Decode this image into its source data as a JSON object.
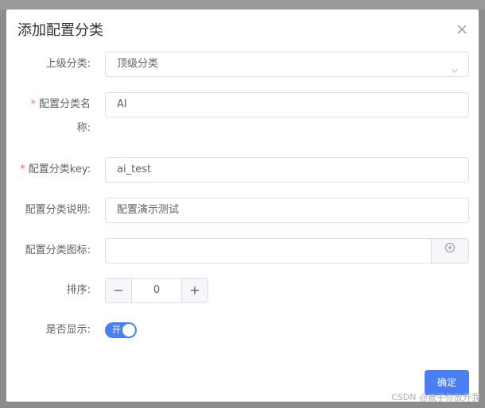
{
  "dialog": {
    "title": "添加配置分类"
  },
  "form": {
    "parent": {
      "label": "上级分类:",
      "value": "顶级分类"
    },
    "name": {
      "required_mark": "*",
      "label_line1": "配置分类名",
      "label_line2": "称:",
      "value": "AI"
    },
    "key": {
      "required_mark": "*",
      "label": "配置分类key:",
      "value": "ai_test"
    },
    "desc": {
      "label": "配置分类说明:",
      "value": "配置演示测试"
    },
    "icon": {
      "label": "配置分类图标:",
      "value": ""
    },
    "sort": {
      "label": "排序:",
      "minus": "−",
      "value": "0",
      "plus": "+"
    },
    "show": {
      "label": "是否显示:",
      "switch_text": "开",
      "on": true
    }
  },
  "footer": {
    "confirm_label": "确定"
  },
  "watermark": "CSDN @被子你放开我",
  "colors": {
    "primary": "#4a7ef5",
    "required": "#f56c6c",
    "border": "#dcdfe6"
  }
}
